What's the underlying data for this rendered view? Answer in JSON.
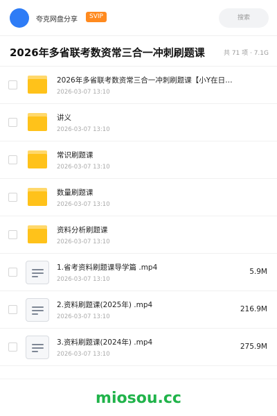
{
  "header": {
    "brand": "夸克网盘分享",
    "badge": "SVIP",
    "search_placeholder": "搜索"
  },
  "titlebar": {
    "title": "2026年多省联考数资常三合一冲刺刷题课",
    "summary": "共 71 项 · 7.1G"
  },
  "items": [
    {
      "type": "folder",
      "name": "2026年多省联考数资常三合一冲刺刷题课【小Y在日…",
      "date": "2026-03-07 13:10",
      "size": ""
    },
    {
      "type": "folder",
      "name": "讲义",
      "date": "2026-03-07 13:10",
      "size": ""
    },
    {
      "type": "folder",
      "name": "常识刷题课",
      "date": "2026-03-07 13:10",
      "size": ""
    },
    {
      "type": "folder",
      "name": "数量刷题课",
      "date": "2026-03-07 13:10",
      "size": ""
    },
    {
      "type": "folder",
      "name": "资料分析刷题课",
      "date": "2026-03-07 13:10",
      "size": ""
    },
    {
      "type": "file",
      "name": "1.省考资料刷题课导学篇 .mp4",
      "date": "2026-03-07 13:10",
      "size": "5.9M"
    },
    {
      "type": "file",
      "name": "2.资料刷题课(2025年) .mp4",
      "date": "2026-03-07 13:10",
      "size": "216.9M"
    },
    {
      "type": "file",
      "name": "3.资料刷题课(2024年) .mp4",
      "date": "2026-03-07 13:10",
      "size": "275.9M"
    }
  ],
  "footer": {
    "watermark": "miosou.cc"
  },
  "colors": {
    "accent": "#2e7cf6",
    "badge": "#ff8a1f",
    "folder": "#ffc21a",
    "watermark": "#20b34a"
  },
  "icons": {
    "folder": "folder-icon",
    "file": "video-file-icon"
  }
}
